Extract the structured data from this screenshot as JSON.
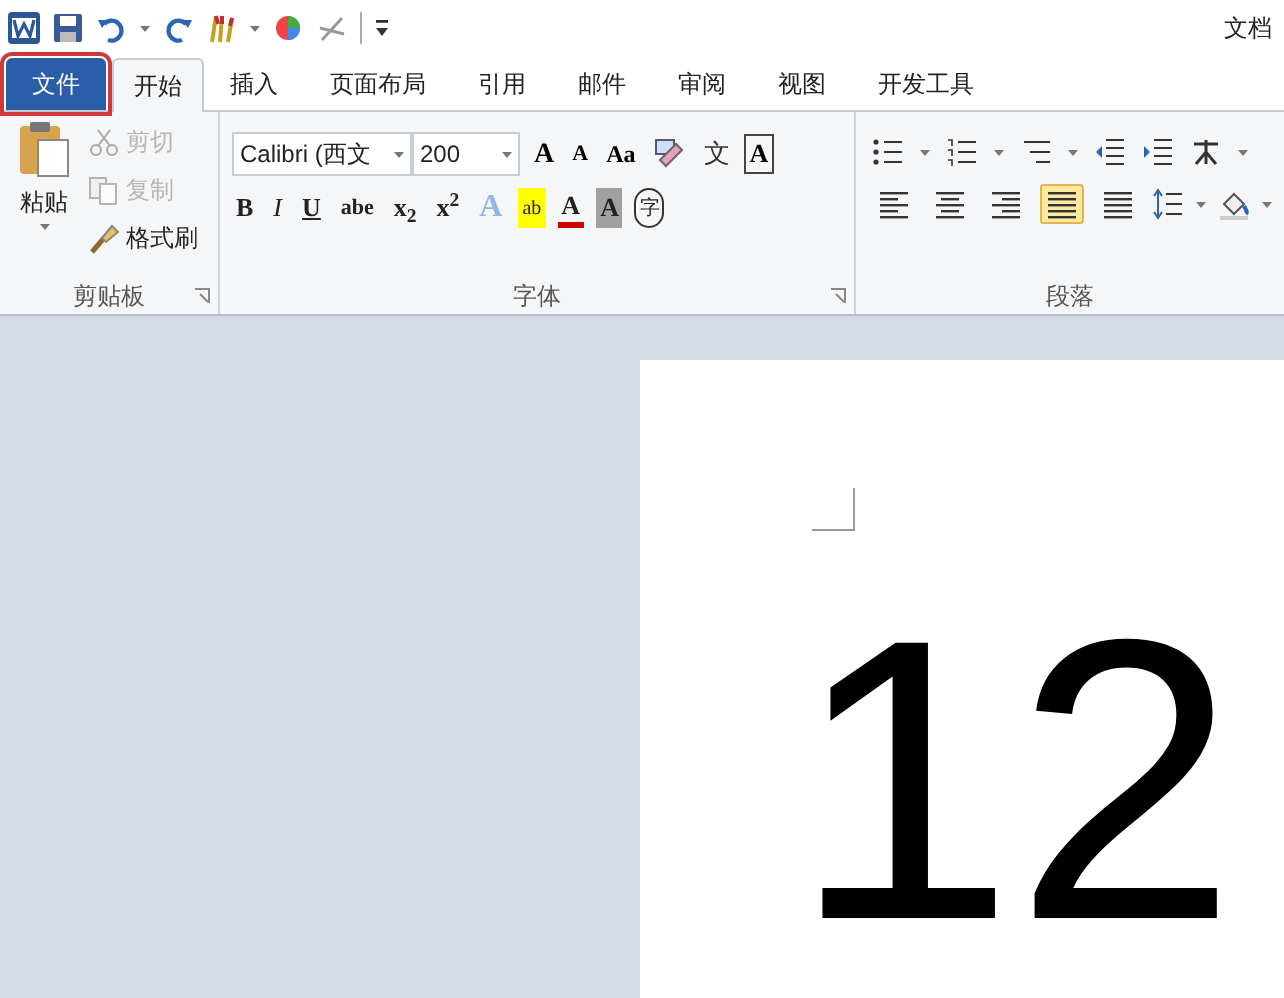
{
  "title": "文档",
  "tabs": [
    {
      "label": "文件",
      "kind": "file",
      "selected": false,
      "outlined": true
    },
    {
      "label": "开始",
      "kind": "tab",
      "selected": true,
      "outlined": false
    },
    {
      "label": "插入",
      "kind": "tab",
      "selected": false,
      "outlined": false
    },
    {
      "label": "页面布局",
      "kind": "tab",
      "selected": false,
      "outlined": false
    },
    {
      "label": "引用",
      "kind": "tab",
      "selected": false,
      "outlined": false
    },
    {
      "label": "邮件",
      "kind": "tab",
      "selected": false,
      "outlined": false
    },
    {
      "label": "审阅",
      "kind": "tab",
      "selected": false,
      "outlined": false
    },
    {
      "label": "视图",
      "kind": "tab",
      "selected": false,
      "outlined": false
    },
    {
      "label": "开发工具",
      "kind": "tab",
      "selected": false,
      "outlined": false
    }
  ],
  "clipboard": {
    "label": "剪贴板",
    "paste": "粘贴",
    "items": [
      {
        "kind": "cut",
        "label": "剪切",
        "disabled": true
      },
      {
        "kind": "copy",
        "label": "复制",
        "disabled": true
      },
      {
        "kind": "painter",
        "label": "格式刷",
        "disabled": false
      }
    ]
  },
  "font": {
    "label": "字体",
    "font_name": "Calibri (西文",
    "font_size": "200",
    "row1": [
      {
        "kind": "grow",
        "label": "A"
      },
      {
        "kind": "shrink",
        "label": "A"
      },
      {
        "kind": "case",
        "label": "Aa"
      },
      {
        "kind": "clear"
      },
      {
        "kind": "phonetic",
        "label": "文"
      },
      {
        "kind": "border",
        "label": "A"
      }
    ],
    "row2": [
      {
        "kind": "bold",
        "label": "B"
      },
      {
        "kind": "italic",
        "label": "I"
      },
      {
        "kind": "underline",
        "label": "U"
      },
      {
        "kind": "strike",
        "label": "abe"
      },
      {
        "kind": "sub",
        "label": "x$_{2}$"
      },
      {
        "kind": "sup",
        "label": "x$^{2}$"
      },
      {
        "kind": "effect",
        "label": "A"
      },
      {
        "kind": "highlight",
        "label": "ab"
      },
      {
        "kind": "color",
        "label": "A"
      },
      {
        "kind": "shading",
        "label": "A"
      },
      {
        "kind": "enclose",
        "label": "字"
      }
    ]
  },
  "paragraph": {
    "label": "段落",
    "align": [
      {
        "kind": "left",
        "selected": false
      },
      {
        "kind": "center",
        "selected": false
      },
      {
        "kind": "right",
        "selected": false
      },
      {
        "kind": "justify",
        "selected": true
      },
      {
        "kind": "distributed",
        "selected": false
      }
    ]
  },
  "document": {
    "text": "12"
  }
}
